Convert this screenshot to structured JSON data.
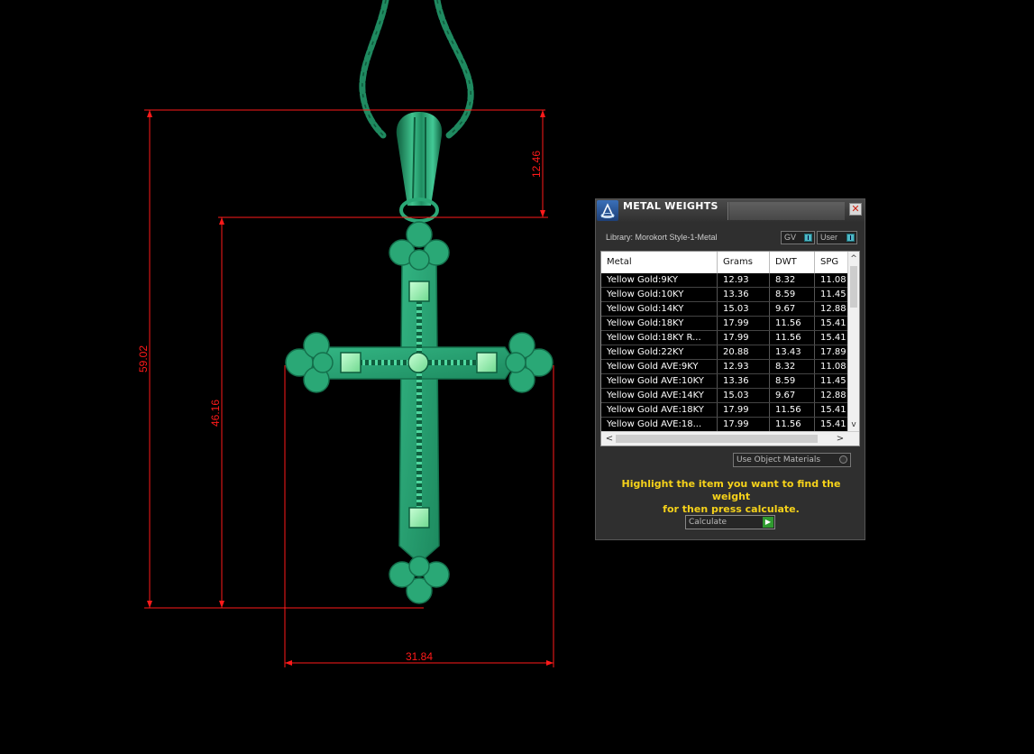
{
  "dimensions": {
    "total_height": "59.02",
    "bail_height": "12.46",
    "cross_height": "46.16",
    "cross_width": "31.84"
  },
  "colors": {
    "dimension_lines": "#ff1a1a",
    "model": "#2aa876",
    "model_dark": "#14704c",
    "gem": "#9ef5b4",
    "hint_text": "#f6d21a",
    "background": "#000000"
  },
  "panel": {
    "title": "METAL WEIGHTS",
    "close_icon": "close-icon",
    "library_label": "Library: Morokort Style-1-Metal",
    "toggle_gv": "GV",
    "toggle_user": "User",
    "columns": [
      "Metal",
      "Grams",
      "DWT",
      "SPG"
    ],
    "rows": [
      {
        "metal": "Yellow Gold:9KY",
        "grams": "12.93",
        "dwt": "8.32",
        "spg": "11.08"
      },
      {
        "metal": "Yellow Gold:10KY",
        "grams": "13.36",
        "dwt": "8.59",
        "spg": "11.45"
      },
      {
        "metal": "Yellow Gold:14KY",
        "grams": "15.03",
        "dwt": "9.67",
        "spg": "12.88"
      },
      {
        "metal": "Yellow Gold:18KY",
        "grams": "17.99",
        "dwt": "11.56",
        "spg": "15.41"
      },
      {
        "metal": "Yellow Gold:18KY R...",
        "grams": "17.99",
        "dwt": "11.56",
        "spg": "15.41"
      },
      {
        "metal": "Yellow Gold:22KY",
        "grams": "20.88",
        "dwt": "13.43",
        "spg": "17.89"
      },
      {
        "metal": "Yellow Gold AVE:9KY",
        "grams": "12.93",
        "dwt": "8.32",
        "spg": "11.08"
      },
      {
        "metal": "Yellow Gold AVE:10KY",
        "grams": "13.36",
        "dwt": "8.59",
        "spg": "11.45"
      },
      {
        "metal": "Yellow Gold AVE:14KY",
        "grams": "15.03",
        "dwt": "9.67",
        "spg": "12.88"
      },
      {
        "metal": "Yellow Gold AVE:18KY",
        "grams": "17.99",
        "dwt": "11.56",
        "spg": "15.41"
      },
      {
        "metal": "Yellow Gold AVE:18...",
        "grams": "17.99",
        "dwt": "11.56",
        "spg": "15.41"
      }
    ],
    "use_object_materials_label": "Use Object Materials",
    "hint_line1": "Highlight the item you want to find the weight",
    "hint_line2": "for then press calculate.",
    "calculate_label": "Calculate"
  }
}
